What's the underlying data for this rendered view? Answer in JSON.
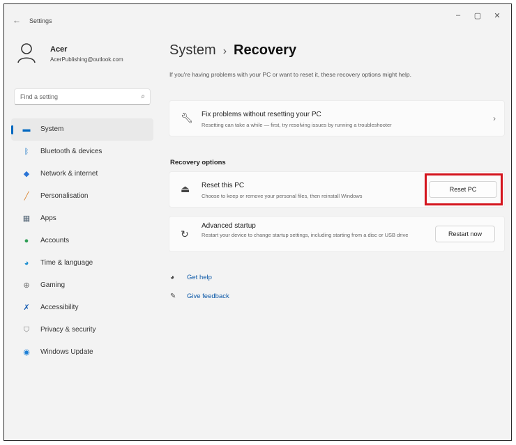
{
  "window": {
    "title": "Settings",
    "minimize": "–",
    "maximize": "▢",
    "close": "✕"
  },
  "profile": {
    "name": "Acer",
    "email": "AcerPublishing@outlook.com"
  },
  "search": {
    "placeholder": "Find a setting"
  },
  "sidebar": {
    "items": [
      {
        "label": "System",
        "icon": "display-icon",
        "color": "#0067c0"
      },
      {
        "label": "Bluetooth & devices",
        "icon": "bluetooth-icon",
        "color": "#0067c0"
      },
      {
        "label": "Network & internet",
        "icon": "network-icon",
        "color": "#2a74d6"
      },
      {
        "label": "Personalisation",
        "icon": "brush-icon",
        "color": "#d9822b"
      },
      {
        "label": "Apps",
        "icon": "apps-icon",
        "color": "#5a6b7b"
      },
      {
        "label": "Accounts",
        "icon": "accounts-icon",
        "color": "#2f9e55"
      },
      {
        "label": "Time & language",
        "icon": "globe-clock-icon",
        "color": "#1d8fd1"
      },
      {
        "label": "Gaming",
        "icon": "gamepad-icon",
        "color": "#6c6c6c"
      },
      {
        "label": "Accessibility",
        "icon": "accessibility-icon",
        "color": "#1a5fb4"
      },
      {
        "label": "Privacy & security",
        "icon": "shield-icon",
        "color": "#777777"
      },
      {
        "label": "Windows Update",
        "icon": "update-icon",
        "color": "#1d7fd6"
      }
    ]
  },
  "main": {
    "breadcrumb_parent": "System",
    "breadcrumb_separator": "›",
    "breadcrumb_current": "Recovery",
    "intro": "If you're having problems with your PC or want to reset it, these recovery options might help.",
    "fix": {
      "title": "Fix problems without resetting your PC",
      "desc": "Resetting can take a while — first, try resolving issues by running a troubleshooter"
    },
    "section_heading": "Recovery options",
    "reset": {
      "title": "Reset this PC",
      "desc": "Choose to keep or remove your personal files, then reinstall Windows",
      "button": "Reset PC"
    },
    "advanced": {
      "title": "Advanced startup",
      "desc": "Restart your device to change startup settings, including starting from a disc or USB drive",
      "button": "Restart now"
    },
    "links": [
      {
        "label": "Get help",
        "icon": "help-icon"
      },
      {
        "label": "Give feedback",
        "icon": "feedback-icon"
      }
    ],
    "highlight_color": "#d4141d"
  }
}
